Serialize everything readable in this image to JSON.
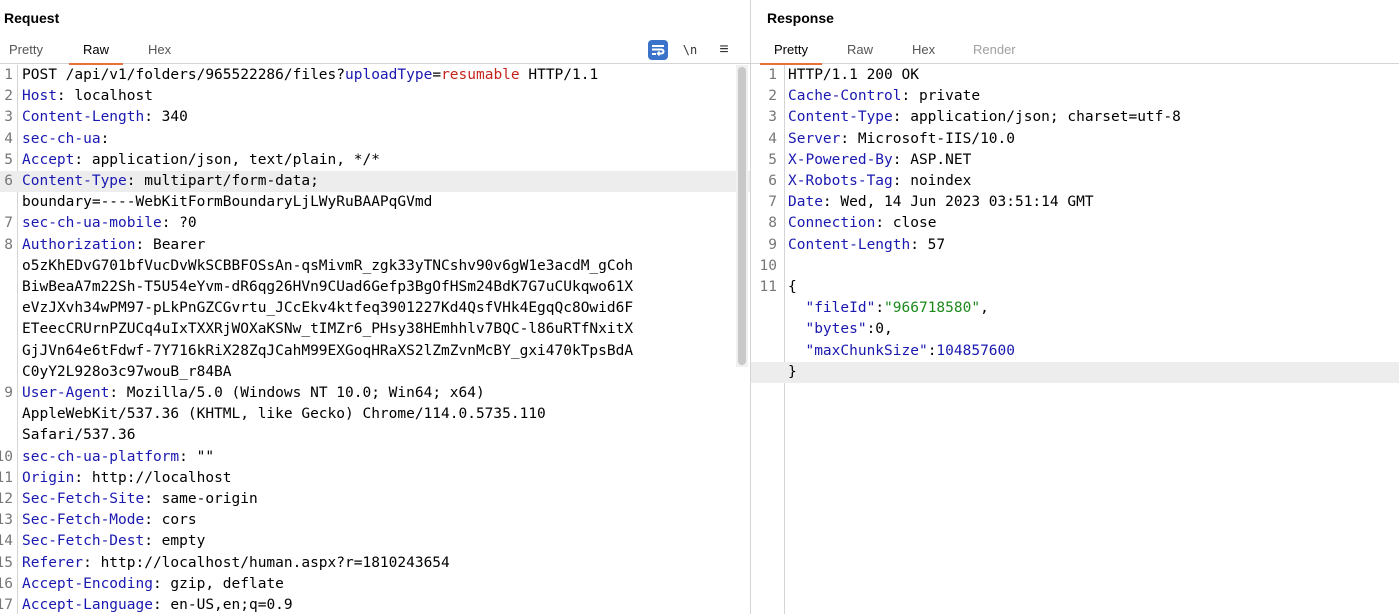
{
  "request": {
    "title": "Request",
    "tabs": [
      "Pretty",
      "Raw",
      "Hex"
    ],
    "active_tab": "Raw",
    "toolbar": {
      "wrap_icon": "wrap-lines-icon",
      "newline_label": "\\n",
      "menu_icon": "hamburger-menu-icon",
      "menu_label": "≡"
    },
    "lines": [
      {
        "n": "1",
        "parts": [
          [
            "POST /api/v1/folders/965522286/files?",
            ""
          ],
          [
            "uploadType",
            "p"
          ],
          [
            "=",
            ""
          ],
          [
            "resumable",
            "v"
          ],
          [
            " HTTP/1.1",
            ""
          ]
        ]
      },
      {
        "n": "2",
        "parts": [
          [
            "Host",
            "k"
          ],
          [
            ": localhost",
            ""
          ]
        ]
      },
      {
        "n": "3",
        "parts": [
          [
            "Content-Length",
            "k"
          ],
          [
            ": 340",
            ""
          ]
        ]
      },
      {
        "n": "4",
        "parts": [
          [
            "sec-ch-ua",
            "k"
          ],
          [
            ":",
            ""
          ]
        ]
      },
      {
        "n": "5",
        "parts": [
          [
            "Accept",
            "k"
          ],
          [
            ": application/json, text/plain, */*",
            ""
          ]
        ]
      },
      {
        "n": "6",
        "hl": true,
        "parts": [
          [
            "Content-Type",
            "k"
          ],
          [
            ": multipart/form-data;",
            ""
          ]
        ]
      },
      {
        "n": "",
        "parts": [
          [
            "boundary=----WebKitFormBoundaryLjLWyRuBAAPqGVmd",
            ""
          ]
        ]
      },
      {
        "n": "7",
        "parts": [
          [
            "sec-ch-ua-mobile",
            "k"
          ],
          [
            ": ?0",
            ""
          ]
        ]
      },
      {
        "n": "8",
        "parts": [
          [
            "Authorization",
            "k"
          ],
          [
            ": Bearer",
            ""
          ]
        ]
      },
      {
        "n": "",
        "parts": [
          [
            "o5zKhEDvG701bfVucDvWkSCBBFOSsAn-qsMivmR_zgk33yTNCshv90v6gW1e3acdM_gCoh",
            ""
          ]
        ]
      },
      {
        "n": "",
        "parts": [
          [
            "BiwBeaA7m22Sh-T5U54eYvm-dR6qg26HVn9CUad6Gefp3BgOfHSm24BdK7G7uCUkqwo61X",
            ""
          ]
        ]
      },
      {
        "n": "",
        "parts": [
          [
            "eVzJXvh34wPM97-pLkPnGZCGvrtu_JCcEkv4ktfeq3901227Kd4QsfVHk4EgqQc8Owid6F",
            ""
          ]
        ]
      },
      {
        "n": "",
        "parts": [
          [
            "ETeecCRUrnPZUCq4uIxTXXRjWOXaKSNw_tIMZr6_PHsy38HEmhhlv7BQC-l86uRTfNxitX",
            ""
          ]
        ]
      },
      {
        "n": "",
        "parts": [
          [
            "GjJVn64e6tFdwf-7Y716kRiX28ZqJCahM99EXGoqHRaXS2lZmZvnMcBY_gxi470kTpsBdA",
            ""
          ]
        ]
      },
      {
        "n": "",
        "parts": [
          [
            "C0yY2L928o3c97wouB_r84BA",
            ""
          ]
        ]
      },
      {
        "n": "9",
        "parts": [
          [
            "User-Agent",
            "k"
          ],
          [
            ": Mozilla/5.0 (Windows NT 10.0; Win64; x64)",
            ""
          ]
        ]
      },
      {
        "n": "",
        "parts": [
          [
            "AppleWebKit/537.36 (KHTML, like Gecko) Chrome/114.0.5735.110",
            ""
          ]
        ]
      },
      {
        "n": "",
        "parts": [
          [
            "Safari/537.36",
            ""
          ]
        ]
      },
      {
        "n": "10",
        "parts": [
          [
            "sec-ch-ua-platform",
            "k"
          ],
          [
            ": \"\"",
            ""
          ]
        ]
      },
      {
        "n": "11",
        "parts": [
          [
            "Origin",
            "k"
          ],
          [
            ": http://localhost",
            ""
          ]
        ]
      },
      {
        "n": "12",
        "parts": [
          [
            "Sec-Fetch-Site",
            "k"
          ],
          [
            ": same-origin",
            ""
          ]
        ]
      },
      {
        "n": "13",
        "parts": [
          [
            "Sec-Fetch-Mode",
            "k"
          ],
          [
            ": cors",
            ""
          ]
        ]
      },
      {
        "n": "14",
        "parts": [
          [
            "Sec-Fetch-Dest",
            "k"
          ],
          [
            ": empty",
            ""
          ]
        ]
      },
      {
        "n": "15",
        "parts": [
          [
            "Referer",
            "k"
          ],
          [
            ": http://localhost/human.aspx?r=1810243654",
            ""
          ]
        ]
      },
      {
        "n": "16",
        "parts": [
          [
            "Accept-Encoding",
            "k"
          ],
          [
            ": gzip, deflate",
            ""
          ]
        ]
      },
      {
        "n": "17",
        "parts": [
          [
            "Accept-Language",
            "k"
          ],
          [
            ": en-US,en;q=0.9",
            ""
          ]
        ]
      }
    ]
  },
  "response": {
    "title": "Response",
    "tabs": [
      "Pretty",
      "Raw",
      "Hex",
      "Render"
    ],
    "active_tab": "Pretty",
    "disabled_tabs": [
      "Render"
    ],
    "lines": [
      {
        "n": "1",
        "parts": [
          [
            "HTTP/1.1 200 OK",
            ""
          ]
        ]
      },
      {
        "n": "2",
        "parts": [
          [
            "Cache-Control",
            "k"
          ],
          [
            ": private",
            ""
          ]
        ]
      },
      {
        "n": "3",
        "parts": [
          [
            "Content-Type",
            "k"
          ],
          [
            ": application/json; charset=utf-8",
            ""
          ]
        ]
      },
      {
        "n": "4",
        "parts": [
          [
            "Server",
            "k"
          ],
          [
            ": Microsoft-IIS/10.0",
            ""
          ]
        ]
      },
      {
        "n": "5",
        "parts": [
          [
            "X-Powered-By",
            "k"
          ],
          [
            ": ASP.NET",
            ""
          ]
        ]
      },
      {
        "n": "6",
        "parts": [
          [
            "X-Robots-Tag",
            "k"
          ],
          [
            ": noindex",
            ""
          ]
        ]
      },
      {
        "n": "7",
        "parts": [
          [
            "Date",
            "k"
          ],
          [
            ": Wed, 14 Jun 2023 03:51:14 GMT",
            ""
          ]
        ]
      },
      {
        "n": "8",
        "parts": [
          [
            "Connection",
            "k"
          ],
          [
            ": close",
            ""
          ]
        ]
      },
      {
        "n": "9",
        "parts": [
          [
            "Content-Length",
            "k"
          ],
          [
            ": 57",
            ""
          ]
        ]
      },
      {
        "n": "10",
        "parts": []
      },
      {
        "n": "11",
        "parts": [
          [
            "{",
            ""
          ]
        ]
      },
      {
        "n": "",
        "parts": [
          [
            "  ",
            ""
          ],
          [
            "\"fileId\"",
            "k"
          ],
          [
            ":",
            ""
          ],
          [
            "\"966718580\"",
            "s"
          ],
          [
            ",",
            ""
          ]
        ]
      },
      {
        "n": "",
        "parts": [
          [
            "  ",
            ""
          ],
          [
            "\"bytes\"",
            "k"
          ],
          [
            ":0,",
            ""
          ]
        ]
      },
      {
        "n": "",
        "parts": [
          [
            "  ",
            ""
          ],
          [
            "\"maxChunkSize\"",
            "k"
          ],
          [
            ":",
            ""
          ],
          [
            "104857600",
            "n"
          ]
        ]
      },
      {
        "n": "",
        "hl": true,
        "parts": [
          [
            "}",
            ""
          ]
        ]
      }
    ]
  }
}
